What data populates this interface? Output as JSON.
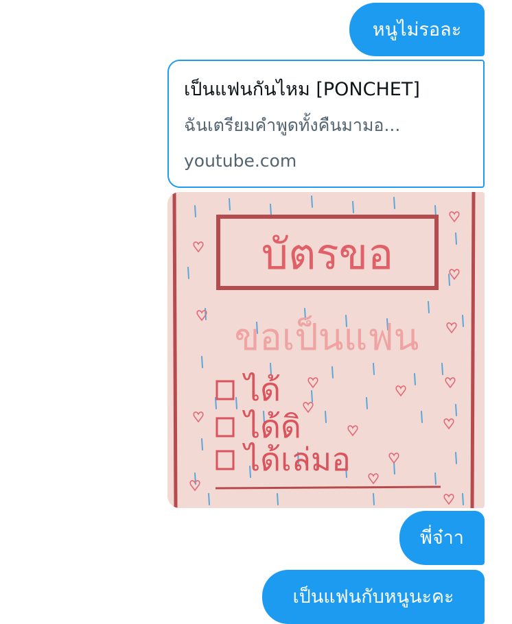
{
  "messages": {
    "msg1": "หนูไม่รอละ",
    "link_card": {
      "title": "เป็นแฟนกันไหม [PONCHET]",
      "description": "ฉันเตรียมคำพูดทั้งคืนมามอ...",
      "domain": "youtube.com"
    },
    "image": {
      "card_title": "บัตรขอ",
      "question": "ขอเป็นแฟน",
      "options": [
        "ได้",
        "ได้ดิ",
        "ได้เล่มอ"
      ]
    },
    "msg2": "พี่จ๋าา",
    "msg3": "เป็นแฟนกับหนูนะคะ"
  },
  "colors": {
    "bubble": "#1d9bf0",
    "bubble_text": "#ffffff",
    "card_border": "#1d9bf0",
    "secondary_text": "#536471",
    "image_bg": "#f2d9d3",
    "image_ink": "#c0434b",
    "image_ink_light": "#e8908f"
  }
}
